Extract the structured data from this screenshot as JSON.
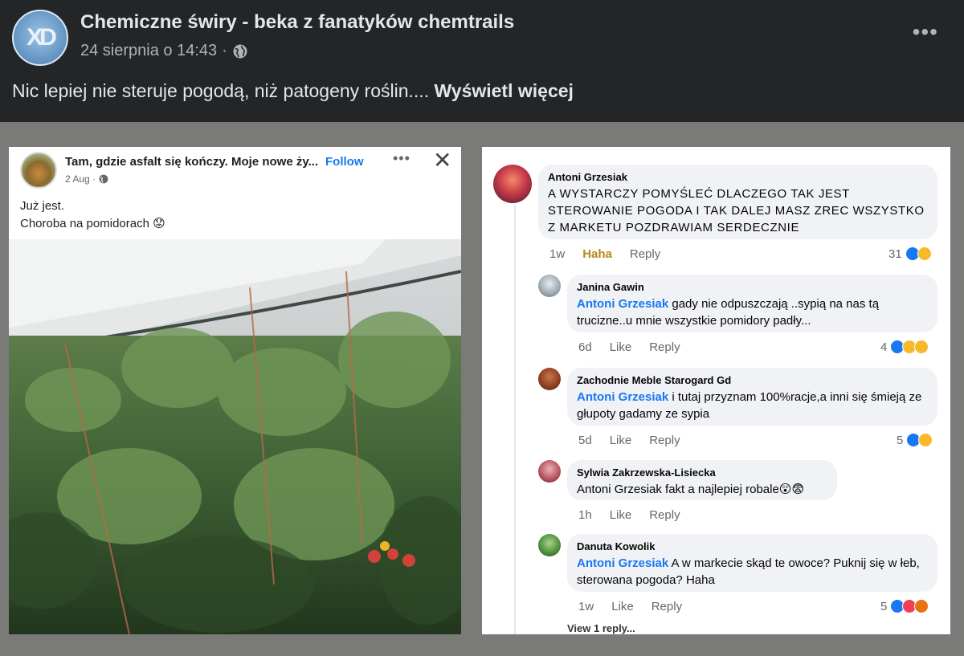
{
  "post": {
    "group_name": "Chemiczne świry - beka z fanatyków chemtrails",
    "date": "24 sierpnia o 14:43",
    "separator": "·",
    "text": "Nic lepiej nie steruje pogodą, niż patogeny roślin.... ",
    "see_more": "Wyświetl więcej",
    "more_icon": "•••"
  },
  "left_card": {
    "author": "Tam, gdzie asfalt się kończy. Moje nowe ży...",
    "separator": "·",
    "follow": "Follow",
    "date": "2 Aug ·",
    "more_icon": "•••",
    "close_icon": "✕",
    "line1": "Już jest.",
    "line2": "Choroba na pomidorach 😟"
  },
  "comments": [
    {
      "name": "Antoni Grzesiak",
      "text": "A WYSTARCZY POMYŚLEĆ  DLACZEGO TAK JEST STEROWANIE  POGODA I TAK  DALEJ  MASZ ZREC  WSZYSTKO Z MARKETU  POZDRAWIAM SERDECZNIE",
      "time": "1w",
      "action1": "Haha",
      "action2": "Reply",
      "count": "31"
    },
    {
      "name": "Janina Gawin",
      "mention": "Antoni Grzesiak",
      "text": " gady  nie odpuszczają  ..sypią  na nas tą trucizne..u mnie wszystkie  pomidory  padły...",
      "time": "6d",
      "action1": "Like",
      "action2": "Reply",
      "count": "4"
    },
    {
      "name": "Zachodnie Meble Starogard Gd",
      "mention": "Antoni Grzesiak",
      "text": " i tutaj przyznam 100%racje,a inni się śmieją ze głupoty gadamy ze sypia",
      "time": "5d",
      "action1": "Like",
      "action2": "Reply",
      "count": "5"
    },
    {
      "name": "Sylwia Zakrzewska-Lisiecka",
      "text": "Antoni Grzesiak fakt a najlepiej robale😲😨",
      "time": "1h",
      "action1": "Like",
      "action2": "Reply"
    },
    {
      "name": "Danuta Kowolik",
      "mention": "Antoni Grzesiak",
      "text": " A w markecie skąd  te owoce? Puknij się w łeb, sterowana pogoda? Haha",
      "time": "1w",
      "action1": "Like",
      "action2": "Reply",
      "count": "5"
    }
  ],
  "view_reply": "View 1 reply...",
  "colors": {
    "fb_blue": "#1877f2",
    "dark_bg": "#242526",
    "bubble": "#f0f2f5"
  }
}
